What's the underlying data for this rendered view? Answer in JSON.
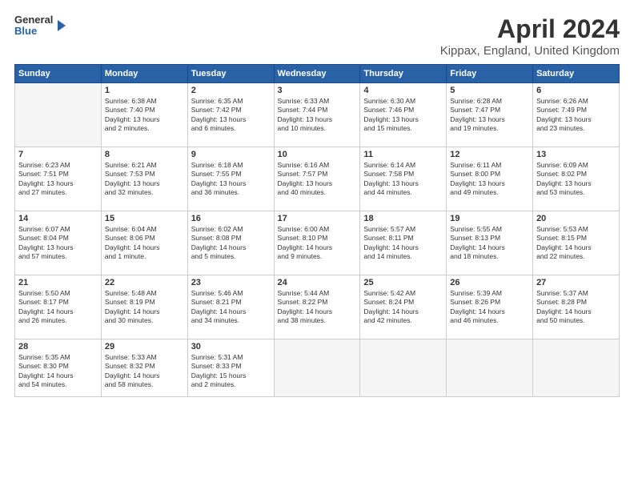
{
  "header": {
    "logo_general": "General",
    "logo_blue": "Blue",
    "month_year": "April 2024",
    "location": "Kippax, England, United Kingdom"
  },
  "calendar": {
    "days_of_week": [
      "Sunday",
      "Monday",
      "Tuesday",
      "Wednesday",
      "Thursday",
      "Friday",
      "Saturday"
    ],
    "weeks": [
      [
        {
          "day": "",
          "info": ""
        },
        {
          "day": "1",
          "info": "Sunrise: 6:38 AM\nSunset: 7:40 PM\nDaylight: 13 hours\nand 2 minutes."
        },
        {
          "day": "2",
          "info": "Sunrise: 6:35 AM\nSunset: 7:42 PM\nDaylight: 13 hours\nand 6 minutes."
        },
        {
          "day": "3",
          "info": "Sunrise: 6:33 AM\nSunset: 7:44 PM\nDaylight: 13 hours\nand 10 minutes."
        },
        {
          "day": "4",
          "info": "Sunrise: 6:30 AM\nSunset: 7:46 PM\nDaylight: 13 hours\nand 15 minutes."
        },
        {
          "day": "5",
          "info": "Sunrise: 6:28 AM\nSunset: 7:47 PM\nDaylight: 13 hours\nand 19 minutes."
        },
        {
          "day": "6",
          "info": "Sunrise: 6:26 AM\nSunset: 7:49 PM\nDaylight: 13 hours\nand 23 minutes."
        }
      ],
      [
        {
          "day": "7",
          "info": "Sunrise: 6:23 AM\nSunset: 7:51 PM\nDaylight: 13 hours\nand 27 minutes."
        },
        {
          "day": "8",
          "info": "Sunrise: 6:21 AM\nSunset: 7:53 PM\nDaylight: 13 hours\nand 32 minutes."
        },
        {
          "day": "9",
          "info": "Sunrise: 6:18 AM\nSunset: 7:55 PM\nDaylight: 13 hours\nand 36 minutes."
        },
        {
          "day": "10",
          "info": "Sunrise: 6:16 AM\nSunset: 7:57 PM\nDaylight: 13 hours\nand 40 minutes."
        },
        {
          "day": "11",
          "info": "Sunrise: 6:14 AM\nSunset: 7:58 PM\nDaylight: 13 hours\nand 44 minutes."
        },
        {
          "day": "12",
          "info": "Sunrise: 6:11 AM\nSunset: 8:00 PM\nDaylight: 13 hours\nand 49 minutes."
        },
        {
          "day": "13",
          "info": "Sunrise: 6:09 AM\nSunset: 8:02 PM\nDaylight: 13 hours\nand 53 minutes."
        }
      ],
      [
        {
          "day": "14",
          "info": "Sunrise: 6:07 AM\nSunset: 8:04 PM\nDaylight: 13 hours\nand 57 minutes."
        },
        {
          "day": "15",
          "info": "Sunrise: 6:04 AM\nSunset: 8:06 PM\nDaylight: 14 hours\nand 1 minute."
        },
        {
          "day": "16",
          "info": "Sunrise: 6:02 AM\nSunset: 8:08 PM\nDaylight: 14 hours\nand 5 minutes."
        },
        {
          "day": "17",
          "info": "Sunrise: 6:00 AM\nSunset: 8:10 PM\nDaylight: 14 hours\nand 9 minutes."
        },
        {
          "day": "18",
          "info": "Sunrise: 5:57 AM\nSunset: 8:11 PM\nDaylight: 14 hours\nand 14 minutes."
        },
        {
          "day": "19",
          "info": "Sunrise: 5:55 AM\nSunset: 8:13 PM\nDaylight: 14 hours\nand 18 minutes."
        },
        {
          "day": "20",
          "info": "Sunrise: 5:53 AM\nSunset: 8:15 PM\nDaylight: 14 hours\nand 22 minutes."
        }
      ],
      [
        {
          "day": "21",
          "info": "Sunrise: 5:50 AM\nSunset: 8:17 PM\nDaylight: 14 hours\nand 26 minutes."
        },
        {
          "day": "22",
          "info": "Sunrise: 5:48 AM\nSunset: 8:19 PM\nDaylight: 14 hours\nand 30 minutes."
        },
        {
          "day": "23",
          "info": "Sunrise: 5:46 AM\nSunset: 8:21 PM\nDaylight: 14 hours\nand 34 minutes."
        },
        {
          "day": "24",
          "info": "Sunrise: 5:44 AM\nSunset: 8:22 PM\nDaylight: 14 hours\nand 38 minutes."
        },
        {
          "day": "25",
          "info": "Sunrise: 5:42 AM\nSunset: 8:24 PM\nDaylight: 14 hours\nand 42 minutes."
        },
        {
          "day": "26",
          "info": "Sunrise: 5:39 AM\nSunset: 8:26 PM\nDaylight: 14 hours\nand 46 minutes."
        },
        {
          "day": "27",
          "info": "Sunrise: 5:37 AM\nSunset: 8:28 PM\nDaylight: 14 hours\nand 50 minutes."
        }
      ],
      [
        {
          "day": "28",
          "info": "Sunrise: 5:35 AM\nSunset: 8:30 PM\nDaylight: 14 hours\nand 54 minutes."
        },
        {
          "day": "29",
          "info": "Sunrise: 5:33 AM\nSunset: 8:32 PM\nDaylight: 14 hours\nand 58 minutes."
        },
        {
          "day": "30",
          "info": "Sunrise: 5:31 AM\nSunset: 8:33 PM\nDaylight: 15 hours\nand 2 minutes."
        },
        {
          "day": "",
          "info": ""
        },
        {
          "day": "",
          "info": ""
        },
        {
          "day": "",
          "info": ""
        },
        {
          "day": "",
          "info": ""
        }
      ]
    ]
  }
}
